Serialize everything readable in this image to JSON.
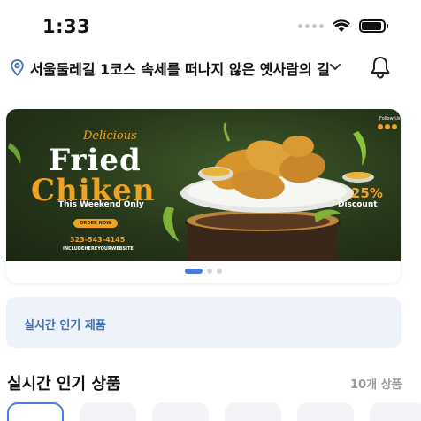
{
  "status_bar": {
    "time": "1:33",
    "icons": [
      "signal-icon",
      "wifi-icon",
      "battery-icon"
    ]
  },
  "header": {
    "location": "서울둘레길 1코스 속세를 떠나지 않은 옛사람의 길",
    "icons": [
      "location-pin-icon",
      "chevron-down-icon",
      "bell-icon"
    ]
  },
  "banner": {
    "script_text": "Delicious",
    "title_line1": "Fried",
    "title_line2": "Chiken",
    "subtitle": "This Weekend Only",
    "order_button": "ORDER NOW",
    "phone": "323-543-4145",
    "website": "INCLUDEHEREYOURWEBSITE",
    "discount_percent": "25%",
    "discount_label": "Discount",
    "follow": "Follow Us",
    "pagination": {
      "pages": 3,
      "active": 1
    }
  },
  "promo": {
    "label": "실시간 인기 제품"
  },
  "section": {
    "title": "실시간 인기 상품",
    "count": "10개 상품"
  },
  "colors": {
    "accent": "#4a7cdb",
    "promo_bg": "#eef3fb",
    "promo_text": "#3f6fb4",
    "banner_orange": "#f0a321"
  }
}
